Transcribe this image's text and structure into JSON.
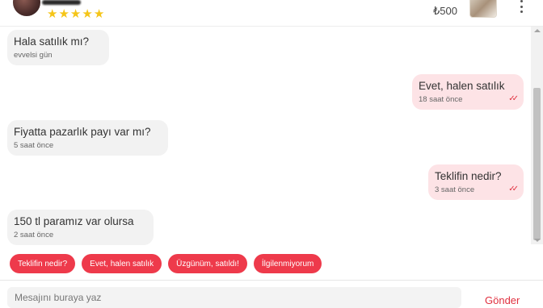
{
  "header": {
    "rating_stars": [
      "★",
      "★",
      "★",
      "★",
      "★"
    ],
    "price": "₺500"
  },
  "messages": [
    {
      "direction": "in",
      "text": "Hala satılık mı?",
      "time": "evvelsi gün"
    },
    {
      "direction": "out",
      "text": "Evet, halen satılık",
      "time": "18 saat önce",
      "read": true
    },
    {
      "direction": "in",
      "text": "Fiyatta pazarlık payı var mı?",
      "time": "5 saat önce"
    },
    {
      "direction": "out",
      "text": "Teklifin nedir?",
      "time": "3 saat önce",
      "read": true
    },
    {
      "direction": "in",
      "text": "150 tl paramız var olursa",
      "time": "2 saat önce"
    }
  ],
  "quick_replies": [
    "Teklifin nedir?",
    "Evet, halen satılık",
    "Üzgünüm, satıldı!",
    "İlgilenmiyorum"
  ],
  "composer": {
    "placeholder": "Mesajını buraya yaz",
    "send_label": "Gönder"
  },
  "colors": {
    "accent": "#ee3a4b",
    "incoming_bubble": "#f2f2f2",
    "outgoing_bubble": "#fde3e6",
    "star": "#f5c518"
  }
}
